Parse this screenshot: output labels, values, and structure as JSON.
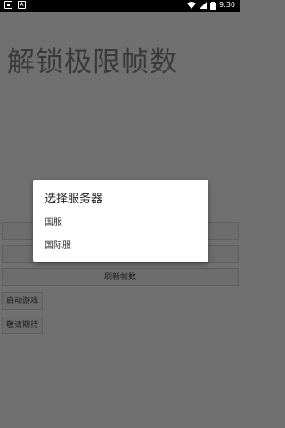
{
  "status_bar": {
    "time": "9:30",
    "icons": [
      "notification-icon-a",
      "notification-icon-b",
      "wifi-icon",
      "signal-icon",
      "battery-icon"
    ]
  },
  "app": {
    "title": "解锁极限帧数"
  },
  "buttons": {
    "refresh_frames": "刷新帧数",
    "start_game": "启动游戏",
    "stay_tuned": "敬请期待"
  },
  "dialog": {
    "title": "选择服务器",
    "options": [
      "国服",
      "国际服"
    ]
  },
  "colors": {
    "scrim": "#707070",
    "dialog_bg": "#ffffff",
    "status_bar_bg": "#000000"
  }
}
